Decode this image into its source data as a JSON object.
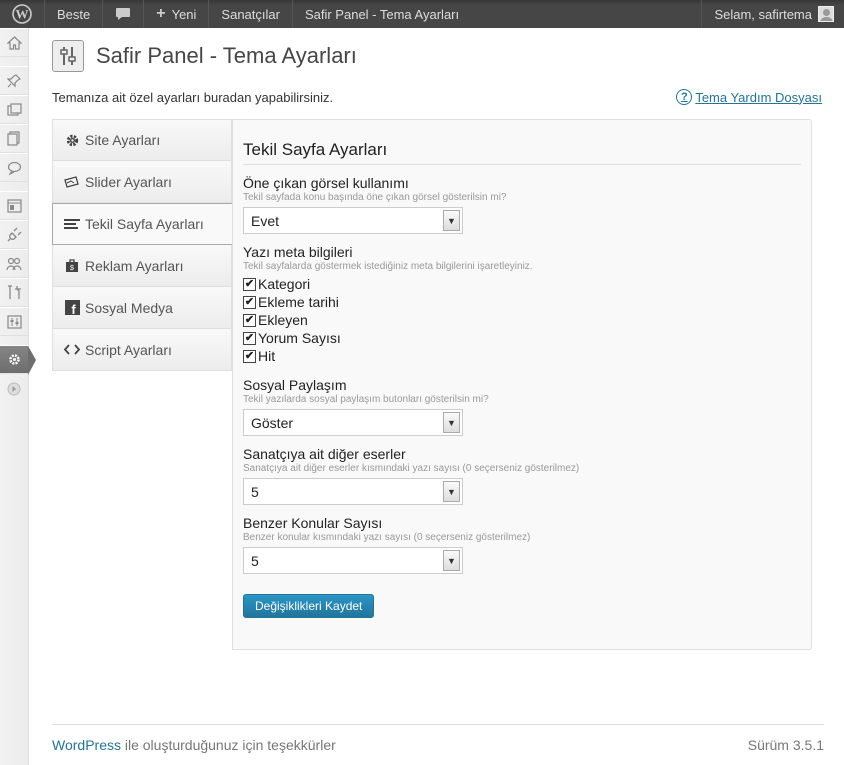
{
  "adminbar": {
    "site_name": "Beste",
    "new_label": "Yeni",
    "artists_label": "Sanatçılar",
    "page_label": "Safir Panel - Tema Ayarları",
    "greeting": "Selam, safirtema"
  },
  "page": {
    "title": "Safir Panel - Tema Ayarları",
    "description": "Temanıza ait özel ayarları buradan yapabilirsiniz.",
    "help_link": "Tema Yardım Dosyası"
  },
  "tabs": [
    {
      "label": "Site Ayarları",
      "icon": "gear-icon"
    },
    {
      "label": "Slider Ayarları",
      "icon": "slider-icon"
    },
    {
      "label": "Tekil Sayfa Ayarları",
      "icon": "lines-icon"
    },
    {
      "label": "Reklam Ayarları",
      "icon": "bag-icon"
    },
    {
      "label": "Sosyal Medya",
      "icon": "facebook-icon"
    },
    {
      "label": "Script Ayarları",
      "icon": "code-icon"
    }
  ],
  "section": {
    "heading": "Tekil Sayfa Ayarları",
    "featured": {
      "label": "Öne çıkan görsel kullanımı",
      "hint": "Tekil sayfada konu başında öne çıkan görsel gösterilsin mi?",
      "value": "Evet"
    },
    "meta": {
      "label": "Yazı meta bilgileri",
      "hint": "Tekil sayfalarda göstermek istediğiniz meta bilgilerini işaretleyiniz.",
      "options": [
        {
          "label": "Kategori",
          "checked": true
        },
        {
          "label": "Ekleme tarihi",
          "checked": true
        },
        {
          "label": "Ekleyen",
          "checked": true
        },
        {
          "label": "Yorum Sayısı",
          "checked": true
        },
        {
          "label": "Hit",
          "checked": true
        }
      ]
    },
    "social": {
      "label": "Sosyal Paylaşım",
      "hint": "Tekil yazılarda sosyal paylaşım butonları gösterilsin mi?",
      "value": "Göster"
    },
    "other_works": {
      "label": "Sanatçıya ait diğer eserler",
      "hint": "Sanatçıya ait diğer eserler kısmındaki yazı sayısı (0 seçerseniz gösterilmez)",
      "value": "5"
    },
    "related": {
      "label": "Benzer Konular Sayısı",
      "hint": "Benzer konular kısmındaki yazı sayısı (0 seçerseniz gösterilmez)",
      "value": "5"
    },
    "save_label": "Değişiklikleri Kaydet"
  },
  "footer": {
    "wp_link": "WordPress",
    "thanks": " ile oluşturduğunuz için teşekkürler",
    "version": "Sürüm 3.5.1"
  },
  "colors": {
    "accent": "#21759b",
    "admin_bar": "#464646"
  }
}
